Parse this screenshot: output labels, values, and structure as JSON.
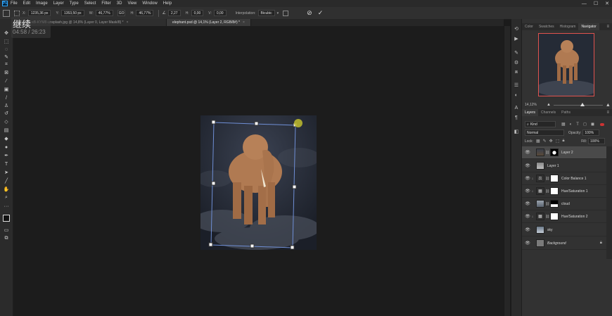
{
  "app": {
    "logo": "Ps"
  },
  "menu": [
    "File",
    "Edit",
    "Image",
    "Layer",
    "Type",
    "Select",
    "Filter",
    "3D",
    "View",
    "Window",
    "Help"
  ],
  "window_controls": {
    "minimize": "—",
    "maximize": "☐",
    "close": "✕"
  },
  "options": {
    "x_label": "X:",
    "x_value": "1235,36 px",
    "y_label": "Y:",
    "y_value": "1353,50 px",
    "w_label": "W:",
    "w_value": "46,77%",
    "link_label": "GO",
    "h_label": "H:",
    "h_value": "46,77%",
    "angle_value": "2,27",
    "hskew_label": "H:",
    "hskew_value": "0,00",
    "vskew_label": "V:",
    "vskew_value": "0,00",
    "interp_label": "Interpolation:",
    "interp_value": "Bicubic",
    "cancel_symbol": "⊘",
    "commit_symbol": "✓"
  },
  "tabs": [
    {
      "label": "s-MOE-xB-KYM8-unsplash.jpg @ 14,8% (Layer 0, Layer Mask/8) *",
      "close": "×"
    },
    {
      "label": "elephant.psd @ 14,1% (Layer 2, RGB/8#) *",
      "close": "×",
      "active": true
    }
  ],
  "overlay": {
    "title": "继续",
    "time": "04:58 / 26:23"
  },
  "panels": {
    "top_tabs": [
      "Color",
      "Swatches",
      "Histogram",
      "Navigator"
    ],
    "zoom": "14,12%",
    "layer_tabs": [
      "Layers",
      "Channels",
      "Paths"
    ],
    "filter_label": "Kind",
    "blend_mode": "Normal",
    "opacity_label": "Opacity:",
    "opacity_value": "100%",
    "lock_label": "Lock:",
    "fill_label": "Fill:",
    "fill_value": "100%"
  },
  "layers": [
    {
      "name": "Layer 2"
    },
    {
      "name": "Layer 1"
    },
    {
      "name": "Color Balance 1"
    },
    {
      "name": "Hue/Saturation 1"
    },
    {
      "name": "cloud"
    },
    {
      "name": "Hue/Saturation 2"
    },
    {
      "name": "sky"
    },
    {
      "name": "Background"
    }
  ],
  "icons": {
    "eye": "eye-icon",
    "lock": "lock-icon",
    "chain": "link-icon",
    "clip": "clipping-arrow-icon"
  },
  "colors": {
    "accent": "#31a8ff",
    "navigator_frame": "#e0534e",
    "rotate_cursor": "#b7b52f"
  }
}
